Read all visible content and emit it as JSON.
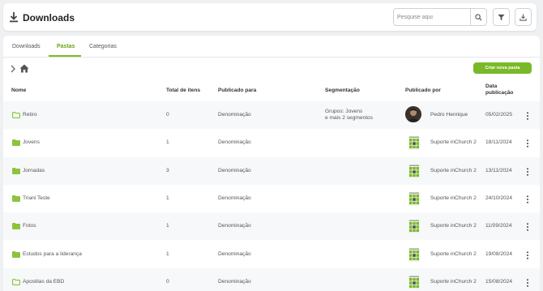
{
  "header": {
    "title": "Downloads",
    "search_placeholder": "Pesquise aqui"
  },
  "tabs": [
    {
      "label": "Downloads"
    },
    {
      "label": "Pastas"
    },
    {
      "label": "Categorias"
    }
  ],
  "toolbar": {
    "new_folder_label": "Criar nova pasta"
  },
  "table": {
    "headers": {
      "name": "Nome",
      "total": "Total de itens",
      "published_for": "Publicado para",
      "segmentation": "Segmentação",
      "published_by": "Publicado por",
      "date_line1": "Data",
      "date_line2": "publicação"
    },
    "rows": [
      {
        "name": "Retiro",
        "total": "0",
        "published_for": "Denominação",
        "seg1": "Grupos: Jovens",
        "seg2": "e mais 2 segmentos",
        "published_by": "Pedro Henrique",
        "date": "05/02/2025"
      },
      {
        "name": "Jovens",
        "total": "1",
        "published_for": "Denominação",
        "seg1": "",
        "seg2": "",
        "published_by": "Suporte inChurch 2",
        "date": "18/11/2024"
      },
      {
        "name": "Jornadas",
        "total": "3",
        "published_for": "Denominação",
        "seg1": "",
        "seg2": "",
        "published_by": "Suporte inChurch 2",
        "date": "13/11/2024"
      },
      {
        "name": "Triani Teste",
        "total": "1",
        "published_for": "Denominação",
        "seg1": "",
        "seg2": "",
        "published_by": "Suporte inChurch 2",
        "date": "24/10/2024"
      },
      {
        "name": "Fotos",
        "total": "1",
        "published_for": "Denominação",
        "seg1": "",
        "seg2": "",
        "published_by": "Suporte inChurch 2",
        "date": "11/09/2024"
      },
      {
        "name": "Estudos para a liderança",
        "total": "1",
        "published_for": "Denominação",
        "seg1": "",
        "seg2": "",
        "published_by": "Suporte inChurch 2",
        "date": "19/08/2024"
      },
      {
        "name": "Apostilas da EBD",
        "total": "0",
        "published_for": "Denominação",
        "seg1": "",
        "seg2": "",
        "published_by": "Suporte inChurch 2",
        "date": "15/08/2024"
      }
    ]
  },
  "colors": {
    "accent": "#79b928",
    "active_tab": "#6aa318",
    "folder_filled": "#8cc43c"
  }
}
